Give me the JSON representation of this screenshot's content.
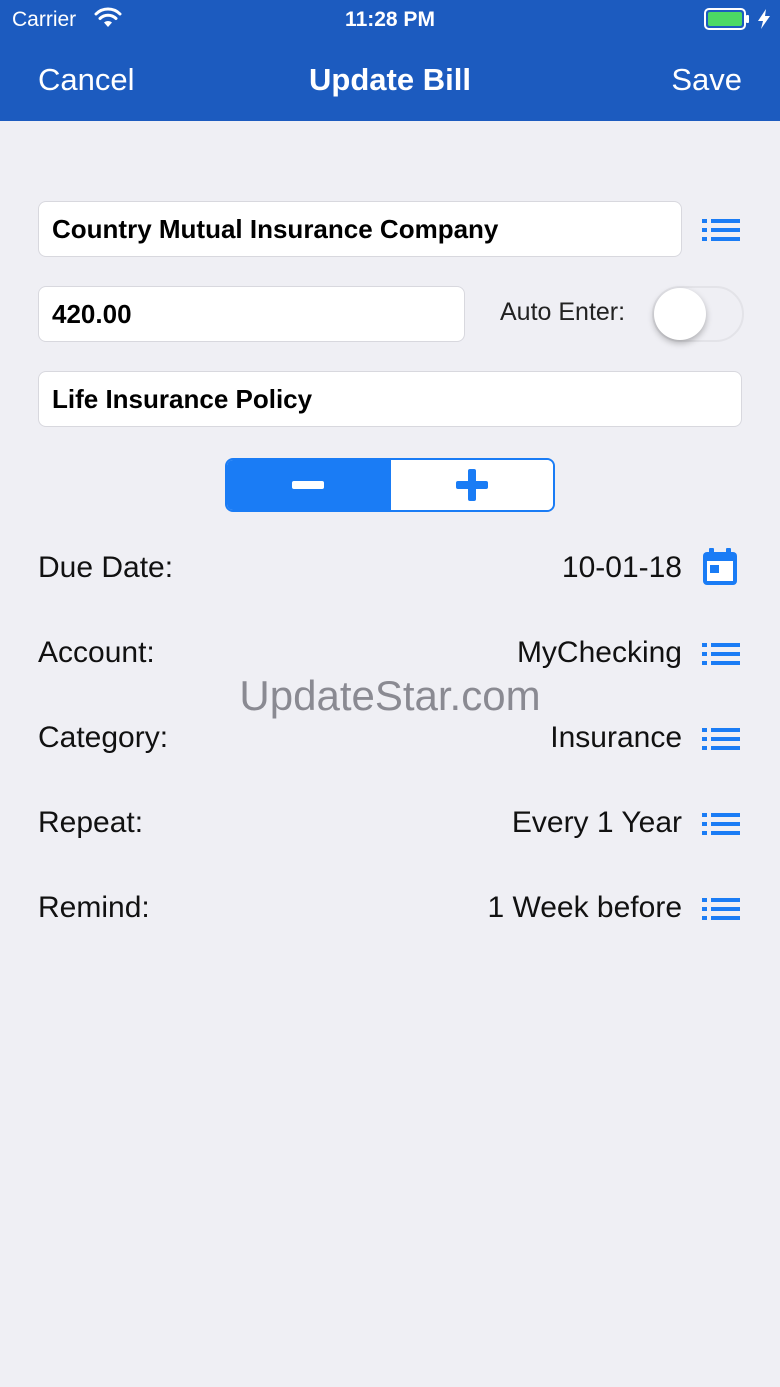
{
  "status_bar": {
    "carrier": "Carrier",
    "time": "11:28 PM",
    "icons": [
      "wifi-icon",
      "battery-icon",
      "charging-bolt-icon"
    ]
  },
  "nav": {
    "cancel_label": "Cancel",
    "title": "Update Bill",
    "save_label": "Save"
  },
  "form": {
    "payee": "Country Mutual Insurance Company",
    "amount": "420.00",
    "auto_enter_label": "Auto Enter:",
    "auto_enter_on": false,
    "memo": "Life Insurance Policy",
    "segment_selected": "minus",
    "rows": [
      {
        "label": "Due Date:",
        "value": "10-01-18",
        "icon": "calendar-icon"
      },
      {
        "label": "Account:",
        "value": "MyChecking",
        "icon": "list-icon"
      },
      {
        "label": "Category:",
        "value": "Insurance",
        "icon": "list-icon"
      },
      {
        "label": "Repeat:",
        "value": "Every 1 Year",
        "icon": "list-icon"
      },
      {
        "label": "Remind:",
        "value": "1 Week before",
        "icon": "list-icon"
      }
    ]
  },
  "watermark": "UpdateStar.com",
  "colors": {
    "nav_bar": "#1c5bbf",
    "accent": "#1a7cf5",
    "background": "#efeff4",
    "battery": "#4cd964"
  }
}
